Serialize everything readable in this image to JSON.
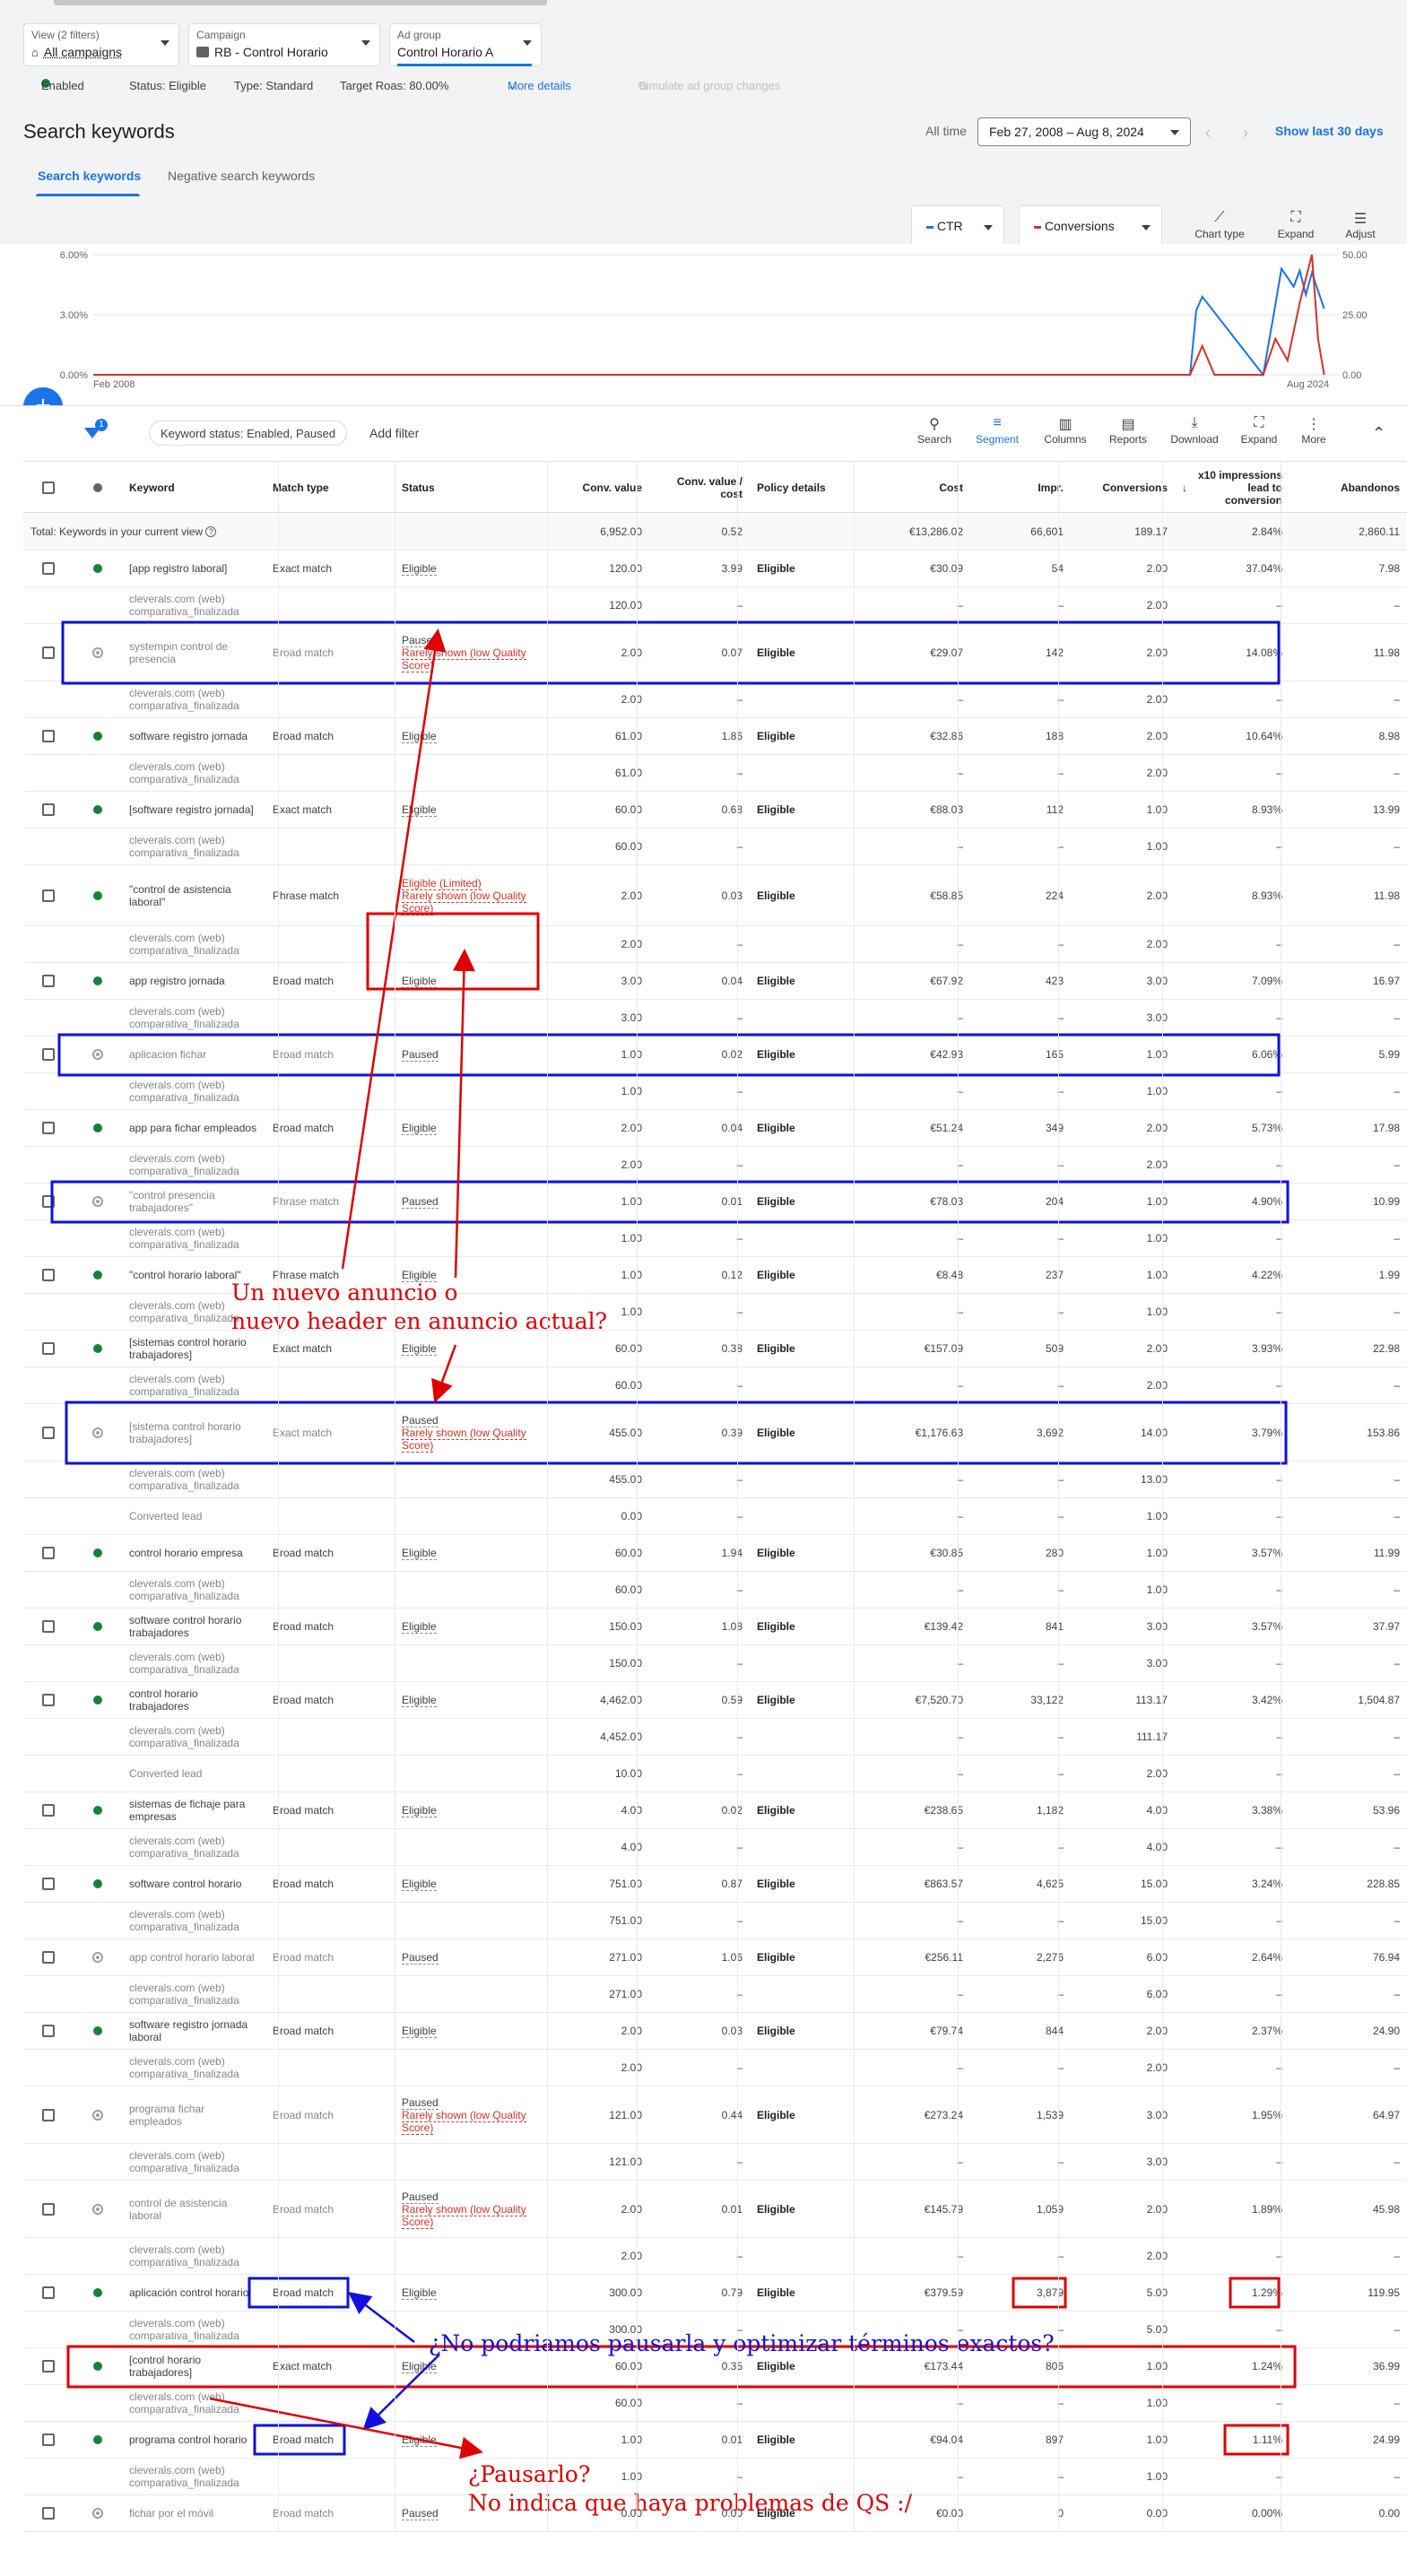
{
  "header": {
    "view": {
      "label": "View (2 filters)",
      "value": "All campaigns"
    },
    "campaign": {
      "label": "Campaign",
      "value": "RB - Control Horario"
    },
    "adgroup": {
      "label": "Ad group",
      "value": "Control Horario A"
    },
    "status_enabled": "Enabled",
    "status": "Status: Eligible",
    "type": "Type: Standard",
    "target_roas": "Target Roas: 80.00%",
    "more_details": "More details",
    "simulate": "Simulate ad group changes"
  },
  "page": {
    "title": "Search keywords",
    "all_time": "All time",
    "date_range": "Feb 27, 2008 – Aug 8, 2024",
    "show_last": "Show last 30 days"
  },
  "tabs": [
    "Search keywords",
    "Negative search keywords"
  ],
  "chart_controls": {
    "metric1": "CTR",
    "metric2": "Conversions",
    "metric1_color": "#1a73e8",
    "metric2_color": "#d93025",
    "chart_type": "Chart type",
    "expand": "Expand",
    "adjust": "Adjust"
  },
  "chart_data": {
    "type": "line",
    "x_labels": [
      "Feb 2008",
      "Aug 2024"
    ],
    "left_axis": [
      "6.00%",
      "3.00%",
      "0.00%"
    ],
    "right_axis": [
      "50.00",
      "25.00",
      "0.00"
    ],
    "series": [
      {
        "name": "CTR",
        "color": "#1a73e8",
        "points": [
          [
            0,
            0
          ],
          [
            0.9,
            0
          ],
          [
            0.905,
            3.2
          ],
          [
            0.91,
            3.9
          ],
          [
            0.96,
            0
          ],
          [
            0.97,
            3.5
          ],
          [
            0.975,
            5.3
          ],
          [
            0.985,
            4.4
          ],
          [
            0.99,
            5.2
          ],
          [
            0.995,
            4.0
          ],
          [
            1.0,
            5.1
          ],
          [
            1.01,
            3.3
          ]
        ]
      },
      {
        "name": "Conversions",
        "color": "#d93025",
        "points": [
          [
            0,
            0
          ],
          [
            0.9,
            0
          ],
          [
            0.91,
            12
          ],
          [
            0.92,
            0
          ],
          [
            0.96,
            0
          ],
          [
            0.97,
            15
          ],
          [
            0.98,
            6
          ],
          [
            0.99,
            30
          ],
          [
            0.995,
            40
          ],
          [
            1.0,
            50
          ],
          [
            1.005,
            15
          ],
          [
            1.01,
            0
          ]
        ]
      }
    ]
  },
  "toolbar": {
    "filter_badge": "1",
    "chip": "Keyword status: Enabled, Paused",
    "add_filter": "Add filter",
    "tools": [
      "Search",
      "Segment",
      "Columns",
      "Reports",
      "Download",
      "Expand",
      "More"
    ]
  },
  "columns": [
    "Keyword",
    "Match type",
    "Status",
    "Conv. value",
    "Conv. value / cost",
    "Policy details",
    "Cost",
    "Impr.",
    "Conversions",
    "x10 impressions lead to conversion",
    "Abandonos"
  ],
  "total": {
    "label": "Total: Keywords in your current view",
    "conv_value": "6,952.00",
    "cvc": "0.52",
    "cost": "€13,286.02",
    "impr": "66,601",
    "conv": "189.17",
    "rate": "2.84%",
    "aband": "2,860.11"
  },
  "rows": [
    {
      "kind": "main",
      "state": "enabled",
      "keyword": "[app registro laboral]",
      "match": "Exact match",
      "status": [
        "Eligible"
      ],
      "cv": "120.00",
      "cvc": "3.99",
      "policy": "Eligible",
      "cost": "€30.09",
      "impr": "54",
      "conv": "2.00",
      "rate": "37.04%",
      "ab": "7.98"
    },
    {
      "kind": "sub",
      "keyword": "cleverals.com (web) comparativa_finalizada",
      "cv": "120.00",
      "cvc": "–",
      "cost": "–",
      "impr": "–",
      "conv": "2.00",
      "rate": "–",
      "ab": "–"
    },
    {
      "kind": "main",
      "state": "paused",
      "keyword": "systempin control de presencia",
      "match": "Broad match",
      "status": [
        "Paused",
        "Rarely shown (low Quality Score)"
      ],
      "cv": "2.00",
      "cvc": "0.07",
      "policy": "Eligible",
      "cost": "€29.07",
      "impr": "142",
      "conv": "2.00",
      "rate": "14.08%",
      "ab": "11.98"
    },
    {
      "kind": "sub",
      "keyword": "cleverals.com (web) comparativa_finalizada",
      "cv": "2.00",
      "cvc": "–",
      "cost": "–",
      "impr": "–",
      "conv": "2.00",
      "rate": "–",
      "ab": "–"
    },
    {
      "kind": "main",
      "state": "enabled",
      "keyword": "software registro jornada",
      "match": "Broad match",
      "status": [
        "Eligible"
      ],
      "cv": "61.00",
      "cvc": "1.86",
      "policy": "Eligible",
      "cost": "€32.86",
      "impr": "188",
      "conv": "2.00",
      "rate": "10.64%",
      "ab": "8.98"
    },
    {
      "kind": "sub",
      "keyword": "cleverals.com (web) comparativa_finalizada",
      "cv": "61.00",
      "cvc": "–",
      "cost": "–",
      "impr": "–",
      "conv": "2.00",
      "rate": "–",
      "ab": "–"
    },
    {
      "kind": "main",
      "state": "enabled",
      "keyword": "[software registro jornada]",
      "match": "Exact match",
      "status": [
        "Eligible"
      ],
      "cv": "60.00",
      "cvc": "0.68",
      "policy": "Eligible",
      "cost": "€88.03",
      "impr": "112",
      "conv": "1.00",
      "rate": "8.93%",
      "ab": "13.99"
    },
    {
      "kind": "sub",
      "keyword": "cleverals.com (web) comparativa_finalizada",
      "cv": "60.00",
      "cvc": "–",
      "cost": "–",
      "impr": "–",
      "conv": "1.00",
      "rate": "–",
      "ab": "–"
    },
    {
      "kind": "main",
      "state": "enabled",
      "keyword": "\"control de asistencia laboral\"",
      "match": "Phrase match",
      "status": [
        "Eligible (Limited)",
        "Rarely shown (low Quality Score)"
      ],
      "statusRed": true,
      "cv": "2.00",
      "cvc": "0.03",
      "policy": "Eligible",
      "cost": "€58.85",
      "impr": "224",
      "conv": "2.00",
      "rate": "8.93%",
      "ab": "11.98"
    },
    {
      "kind": "sub",
      "keyword": "cleverals.com (web) comparativa_finalizada",
      "cv": "2.00",
      "cvc": "–",
      "cost": "–",
      "impr": "–",
      "conv": "2.00",
      "rate": "–",
      "ab": "–"
    },
    {
      "kind": "main",
      "state": "enabled",
      "keyword": "app registro jornada",
      "match": "Broad match",
      "status": [
        "Eligible"
      ],
      "cv": "3.00",
      "cvc": "0.04",
      "policy": "Eligible",
      "cost": "€67.92",
      "impr": "423",
      "conv": "3.00",
      "rate": "7.09%",
      "ab": "16.97"
    },
    {
      "kind": "sub",
      "keyword": "cleverals.com (web) comparativa_finalizada",
      "cv": "3.00",
      "cvc": "–",
      "cost": "–",
      "impr": "–",
      "conv": "3.00",
      "rate": "–",
      "ab": "–"
    },
    {
      "kind": "main",
      "state": "paused",
      "keyword": "aplicacion fichar",
      "match": "Broad match",
      "status": [
        "Paused"
      ],
      "cv": "1.00",
      "cvc": "0.02",
      "policy": "Eligible",
      "cost": "€42.93",
      "impr": "165",
      "conv": "1.00",
      "rate": "6.06%",
      "ab": "5.99"
    },
    {
      "kind": "sub",
      "keyword": "cleverals.com (web) comparativa_finalizada",
      "cv": "1.00",
      "cvc": "–",
      "cost": "–",
      "impr": "–",
      "conv": "1.00",
      "rate": "–",
      "ab": "–"
    },
    {
      "kind": "main",
      "state": "enabled",
      "keyword": "app para fichar empleados",
      "match": "Broad match",
      "status": [
        "Eligible"
      ],
      "cv": "2.00",
      "cvc": "0.04",
      "policy": "Eligible",
      "cost": "€51.24",
      "impr": "349",
      "conv": "2.00",
      "rate": "5.73%",
      "ab": "17.98"
    },
    {
      "kind": "sub",
      "keyword": "cleverals.com (web) comparativa_finalizada",
      "cv": "2.00",
      "cvc": "–",
      "cost": "–",
      "impr": "–",
      "conv": "2.00",
      "rate": "–",
      "ab": "–"
    },
    {
      "kind": "main",
      "state": "paused",
      "keyword": "\"control presencia trabajadores\"",
      "match": "Phrase match",
      "status": [
        "Paused"
      ],
      "cv": "1.00",
      "cvc": "0.01",
      "policy": "Eligible",
      "cost": "€78.03",
      "impr": "204",
      "conv": "1.00",
      "rate": "4.90%",
      "ab": "10.99"
    },
    {
      "kind": "sub",
      "keyword": "cleverals.com (web) comparativa_finalizada",
      "cv": "1.00",
      "cvc": "–",
      "cost": "–",
      "impr": "–",
      "conv": "1.00",
      "rate": "–",
      "ab": "–"
    },
    {
      "kind": "main",
      "state": "enabled",
      "keyword": "\"control horario laboral\"",
      "match": "Phrase match",
      "status": [
        "Eligible"
      ],
      "cv": "1.00",
      "cvc": "0.12",
      "policy": "Eligible",
      "cost": "€8.48",
      "impr": "237",
      "conv": "1.00",
      "rate": "4.22%",
      "ab": "1.99"
    },
    {
      "kind": "sub",
      "keyword": "cleverals.com (web) comparativa_finalizada",
      "cv": "1.00",
      "cvc": "–",
      "cost": "–",
      "impr": "–",
      "conv": "1.00",
      "rate": "–",
      "ab": "–"
    },
    {
      "kind": "main",
      "state": "enabled",
      "keyword": "[sistemas control horario trabajadores]",
      "match": "Exact match",
      "status": [
        "Eligible"
      ],
      "cv": "60.00",
      "cvc": "0.38",
      "policy": "Eligible",
      "cost": "€157.09",
      "impr": "509",
      "conv": "2.00",
      "rate": "3.93%",
      "ab": "22.98"
    },
    {
      "kind": "sub",
      "keyword": "cleverals.com (web) comparativa_finalizada",
      "cv": "60.00",
      "cvc": "–",
      "cost": "–",
      "impr": "–",
      "conv": "2.00",
      "rate": "–",
      "ab": "–"
    },
    {
      "kind": "main",
      "state": "paused",
      "keyword": "[sistema control horario trabajadores]",
      "match": "Exact match",
      "status": [
        "Paused",
        "Rarely shown (low Quality Score)"
      ],
      "cv": "455.00",
      "cvc": "0.39",
      "policy": "Eligible",
      "cost": "€1,176.63",
      "impr": "3,692",
      "conv": "14.00",
      "rate": "3.79%",
      "ab": "153.86"
    },
    {
      "kind": "sub",
      "keyword": "cleverals.com (web) comparativa_finalizada",
      "cv": "455.00",
      "cvc": "–",
      "cost": "–",
      "impr": "–",
      "conv": "13.00",
      "rate": "–",
      "ab": "–"
    },
    {
      "kind": "sub",
      "keyword": "Converted lead",
      "cv": "0.00",
      "cvc": "–",
      "cost": "–",
      "impr": "–",
      "conv": "1.00",
      "rate": "–",
      "ab": "–"
    },
    {
      "kind": "main",
      "state": "enabled",
      "keyword": "control horario empresa",
      "match": "Broad match",
      "status": [
        "Eligible"
      ],
      "cv": "60.00",
      "cvc": "1.94",
      "policy": "Eligible",
      "cost": "€30.85",
      "impr": "280",
      "conv": "1.00",
      "rate": "3.57%",
      "ab": "11.99"
    },
    {
      "kind": "sub",
      "keyword": "cleverals.com (web) comparativa_finalizada",
      "cv": "60.00",
      "cvc": "–",
      "cost": "–",
      "impr": "–",
      "conv": "1.00",
      "rate": "–",
      "ab": "–"
    },
    {
      "kind": "main",
      "state": "enabled",
      "keyword": "software control horario trabajadores",
      "match": "Broad match",
      "status": [
        "Eligible"
      ],
      "cv": "150.00",
      "cvc": "1.08",
      "policy": "Eligible",
      "cost": "€139.42",
      "impr": "841",
      "conv": "3.00",
      "rate": "3.57%",
      "ab": "37.97"
    },
    {
      "kind": "sub",
      "keyword": "cleverals.com (web) comparativa_finalizada",
      "cv": "150.00",
      "cvc": "–",
      "cost": "–",
      "impr": "–",
      "conv": "3.00",
      "rate": "–",
      "ab": "–"
    },
    {
      "kind": "main",
      "state": "enabled",
      "keyword": "control horario trabajadores",
      "match": "Broad match",
      "status": [
        "Eligible"
      ],
      "cv": "4,462.00",
      "cvc": "0.59",
      "policy": "Eligible",
      "cost": "€7,520.70",
      "impr": "33,122",
      "conv": "113.17",
      "rate": "3.42%",
      "ab": "1,504.87"
    },
    {
      "kind": "sub",
      "keyword": "cleverals.com (web) comparativa_finalizada",
      "cv": "4,452.00",
      "cvc": "–",
      "cost": "–",
      "impr": "–",
      "conv": "111.17",
      "rate": "–",
      "ab": "–"
    },
    {
      "kind": "sub",
      "keyword": "Converted lead",
      "cv": "10.00",
      "cvc": "–",
      "cost": "–",
      "impr": "–",
      "conv": "2.00",
      "rate": "–",
      "ab": "–"
    },
    {
      "kind": "main",
      "state": "enabled",
      "keyword": "sistemas de fichaje para empresas",
      "match": "Broad match",
      "status": [
        "Eligible"
      ],
      "cv": "4.00",
      "cvc": "0.02",
      "policy": "Eligible",
      "cost": "€238.65",
      "impr": "1,182",
      "conv": "4.00",
      "rate": "3.38%",
      "ab": "53.96"
    },
    {
      "kind": "sub",
      "keyword": "cleverals.com (web) comparativa_finalizada",
      "cv": "4.00",
      "cvc": "–",
      "cost": "–",
      "impr": "–",
      "conv": "4.00",
      "rate": "–",
      "ab": "–"
    },
    {
      "kind": "main",
      "state": "enabled",
      "keyword": "software control horario",
      "match": "Broad match",
      "status": [
        "Eligible"
      ],
      "cv": "751.00",
      "cvc": "0.87",
      "policy": "Eligible",
      "cost": "€863.57",
      "impr": "4,625",
      "conv": "15.00",
      "rate": "3.24%",
      "ab": "228.85"
    },
    {
      "kind": "sub",
      "keyword": "cleverals.com (web) comparativa_finalizada",
      "cv": "751.00",
      "cvc": "–",
      "cost": "–",
      "impr": "–",
      "conv": "15.00",
      "rate": "–",
      "ab": "–"
    },
    {
      "kind": "main",
      "state": "paused",
      "keyword": "app control horario laboral",
      "match": "Broad match",
      "status": [
        "Paused"
      ],
      "cv": "271.00",
      "cvc": "1.06",
      "policy": "Eligible",
      "cost": "€256.11",
      "impr": "2,276",
      "conv": "6.00",
      "rate": "2.64%",
      "ab": "76.94"
    },
    {
      "kind": "sub",
      "keyword": "cleverals.com (web) comparativa_finalizada",
      "cv": "271.00",
      "cvc": "–",
      "cost": "–",
      "impr": "–",
      "conv": "6.00",
      "rate": "–",
      "ab": "–"
    },
    {
      "kind": "main",
      "state": "enabled",
      "keyword": "software registro jornada laboral",
      "match": "Broad match",
      "status": [
        "Eligible"
      ],
      "cv": "2.00",
      "cvc": "0.03",
      "policy": "Eligible",
      "cost": "€79.74",
      "impr": "844",
      "conv": "2.00",
      "rate": "2.37%",
      "ab": "24.90"
    },
    {
      "kind": "sub",
      "keyword": "cleverals.com (web) comparativa_finalizada",
      "cv": "2.00",
      "cvc": "–",
      "cost": "–",
      "impr": "–",
      "conv": "2.00",
      "rate": "–",
      "ab": "–"
    },
    {
      "kind": "main",
      "state": "paused",
      "keyword": "programa fichar empleados",
      "match": "Broad match",
      "status": [
        "Paused",
        "Rarely shown (low Quality Score)"
      ],
      "cv": "121.00",
      "cvc": "0.44",
      "policy": "Eligible",
      "cost": "€273.24",
      "impr": "1,539",
      "conv": "3.00",
      "rate": "1.95%",
      "ab": "64.97"
    },
    {
      "kind": "sub",
      "keyword": "cleverals.com (web) comparativa_finalizada",
      "cv": "121.00",
      "cvc": "–",
      "cost": "–",
      "impr": "–",
      "conv": "3.00",
      "rate": "–",
      "ab": "–"
    },
    {
      "kind": "main",
      "state": "paused",
      "keyword": "control de asistencia laboral",
      "match": "Broad match",
      "status": [
        "Paused",
        "Rarely shown (low Quality Score)"
      ],
      "cv": "2.00",
      "cvc": "0.01",
      "policy": "Eligible",
      "cost": "€145.79",
      "impr": "1,059",
      "conv": "2.00",
      "rate": "1.89%",
      "ab": "45.98"
    },
    {
      "kind": "sub",
      "keyword": "cleverals.com (web) comparativa_finalizada",
      "cv": "2.00",
      "cvc": "–",
      "cost": "–",
      "impr": "–",
      "conv": "2.00",
      "rate": "–",
      "ab": "–"
    },
    {
      "kind": "main",
      "state": "enabled",
      "keyword": "aplicación control horario",
      "match": "Broad match",
      "status": [
        "Eligible"
      ],
      "cv": "300.00",
      "cvc": "0.79",
      "policy": "Eligible",
      "cost": "€379.59",
      "impr": "3,879",
      "conv": "5.00",
      "rate": "1.29%",
      "ab": "119.95"
    },
    {
      "kind": "sub",
      "keyword": "cleverals.com (web) comparativa_finalizada",
      "cv": "300.00",
      "cvc": "–",
      "cost": "–",
      "impr": "–",
      "conv": "5.00",
      "rate": "–",
      "ab": "–"
    },
    {
      "kind": "main",
      "state": "enabled",
      "keyword": "[control horario trabajadores]",
      "match": "Exact match",
      "status": [
        "Eligible"
      ],
      "cv": "60.00",
      "cvc": "0.35",
      "policy": "Eligible",
      "cost": "€173.44",
      "impr": "806",
      "conv": "1.00",
      "rate": "1.24%",
      "ab": "36.99"
    },
    {
      "kind": "sub",
      "keyword": "cleverals.com (web) comparativa_finalizada",
      "cv": "60.00",
      "cvc": "–",
      "cost": "–",
      "impr": "–",
      "conv": "1.00",
      "rate": "–",
      "ab": "–"
    },
    {
      "kind": "main",
      "state": "enabled",
      "keyword": "programa control horario",
      "match": "Broad match",
      "status": [
        "Eligible"
      ],
      "cv": "1.00",
      "cvc": "0.01",
      "policy": "Eligible",
      "cost": "€94.04",
      "impr": "897",
      "conv": "1.00",
      "rate": "1.11%",
      "ab": "24.99"
    },
    {
      "kind": "sub",
      "keyword": "cleverals.com (web) comparativa_finalizada",
      "cv": "1.00",
      "cvc": "–",
      "cost": "–",
      "impr": "–",
      "conv": "1.00",
      "rate": "–",
      "ab": "–"
    },
    {
      "kind": "main",
      "state": "paused",
      "keyword": "fichar por el móvil",
      "match": "Broad match",
      "status": [
        "Paused"
      ],
      "cv": "0.00",
      "cvc": "0.00",
      "policy": "Eligible",
      "cost": "€0.00",
      "impr": "0",
      "conv": "0.00",
      "rate": "0.00%",
      "ab": "0.00"
    }
  ],
  "annotations": {
    "note1": [
      "Un nuevo anuncio o",
      "nuevo header en anuncio actual?"
    ],
    "note2": "¿No podriamos pausarla y optimizar términos exactos?",
    "note3": [
      "¿Pausarlo?",
      "No indica que haya problemas de QS :/"
    ],
    "red": "#e00000",
    "blue": "#1010dd"
  }
}
